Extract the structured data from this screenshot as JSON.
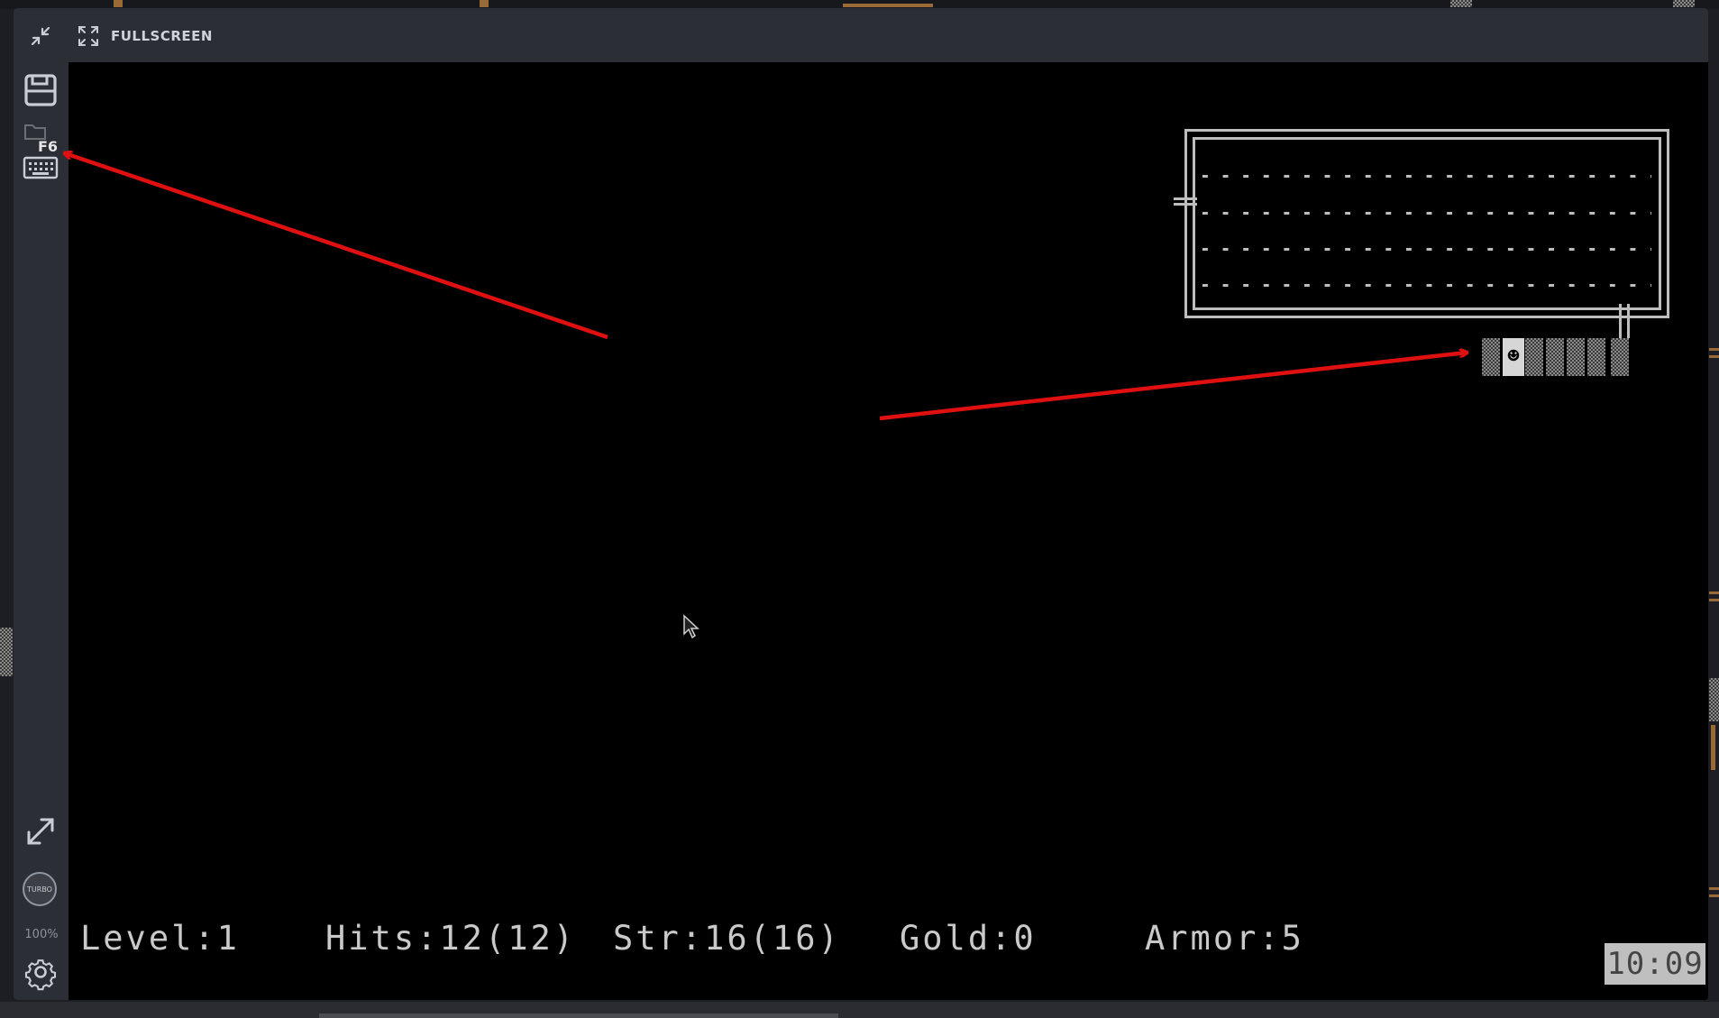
{
  "toolbar": {
    "exit_icon": "arrows-in-icon",
    "fullscreen_icon": "expand-corners-icon",
    "fullscreen_label": "FULLSCREEN"
  },
  "sidebar": {
    "save_icon": "floppy-disk-icon",
    "load_hotkey_label": "F6",
    "keyboard_icon": "keyboard-icon",
    "resize_icon": "diagonal-arrows-icon",
    "turbo_label": "TURBO",
    "zoom_label": "100%",
    "settings_icon": "gear-icon"
  },
  "game": {
    "player_glyph": "☻",
    "status": {
      "level": "Level:1",
      "hits": "Hits:12(12)",
      "str": "Str:16(16)",
      "gold": "Gold:0",
      "armor": "Armor:5"
    },
    "clock": "10:09"
  },
  "colors": {
    "chrome": "#2b2e35",
    "screen": "#000000",
    "map_gray": "#bdbdbd",
    "annotation_red": "#e01010"
  }
}
